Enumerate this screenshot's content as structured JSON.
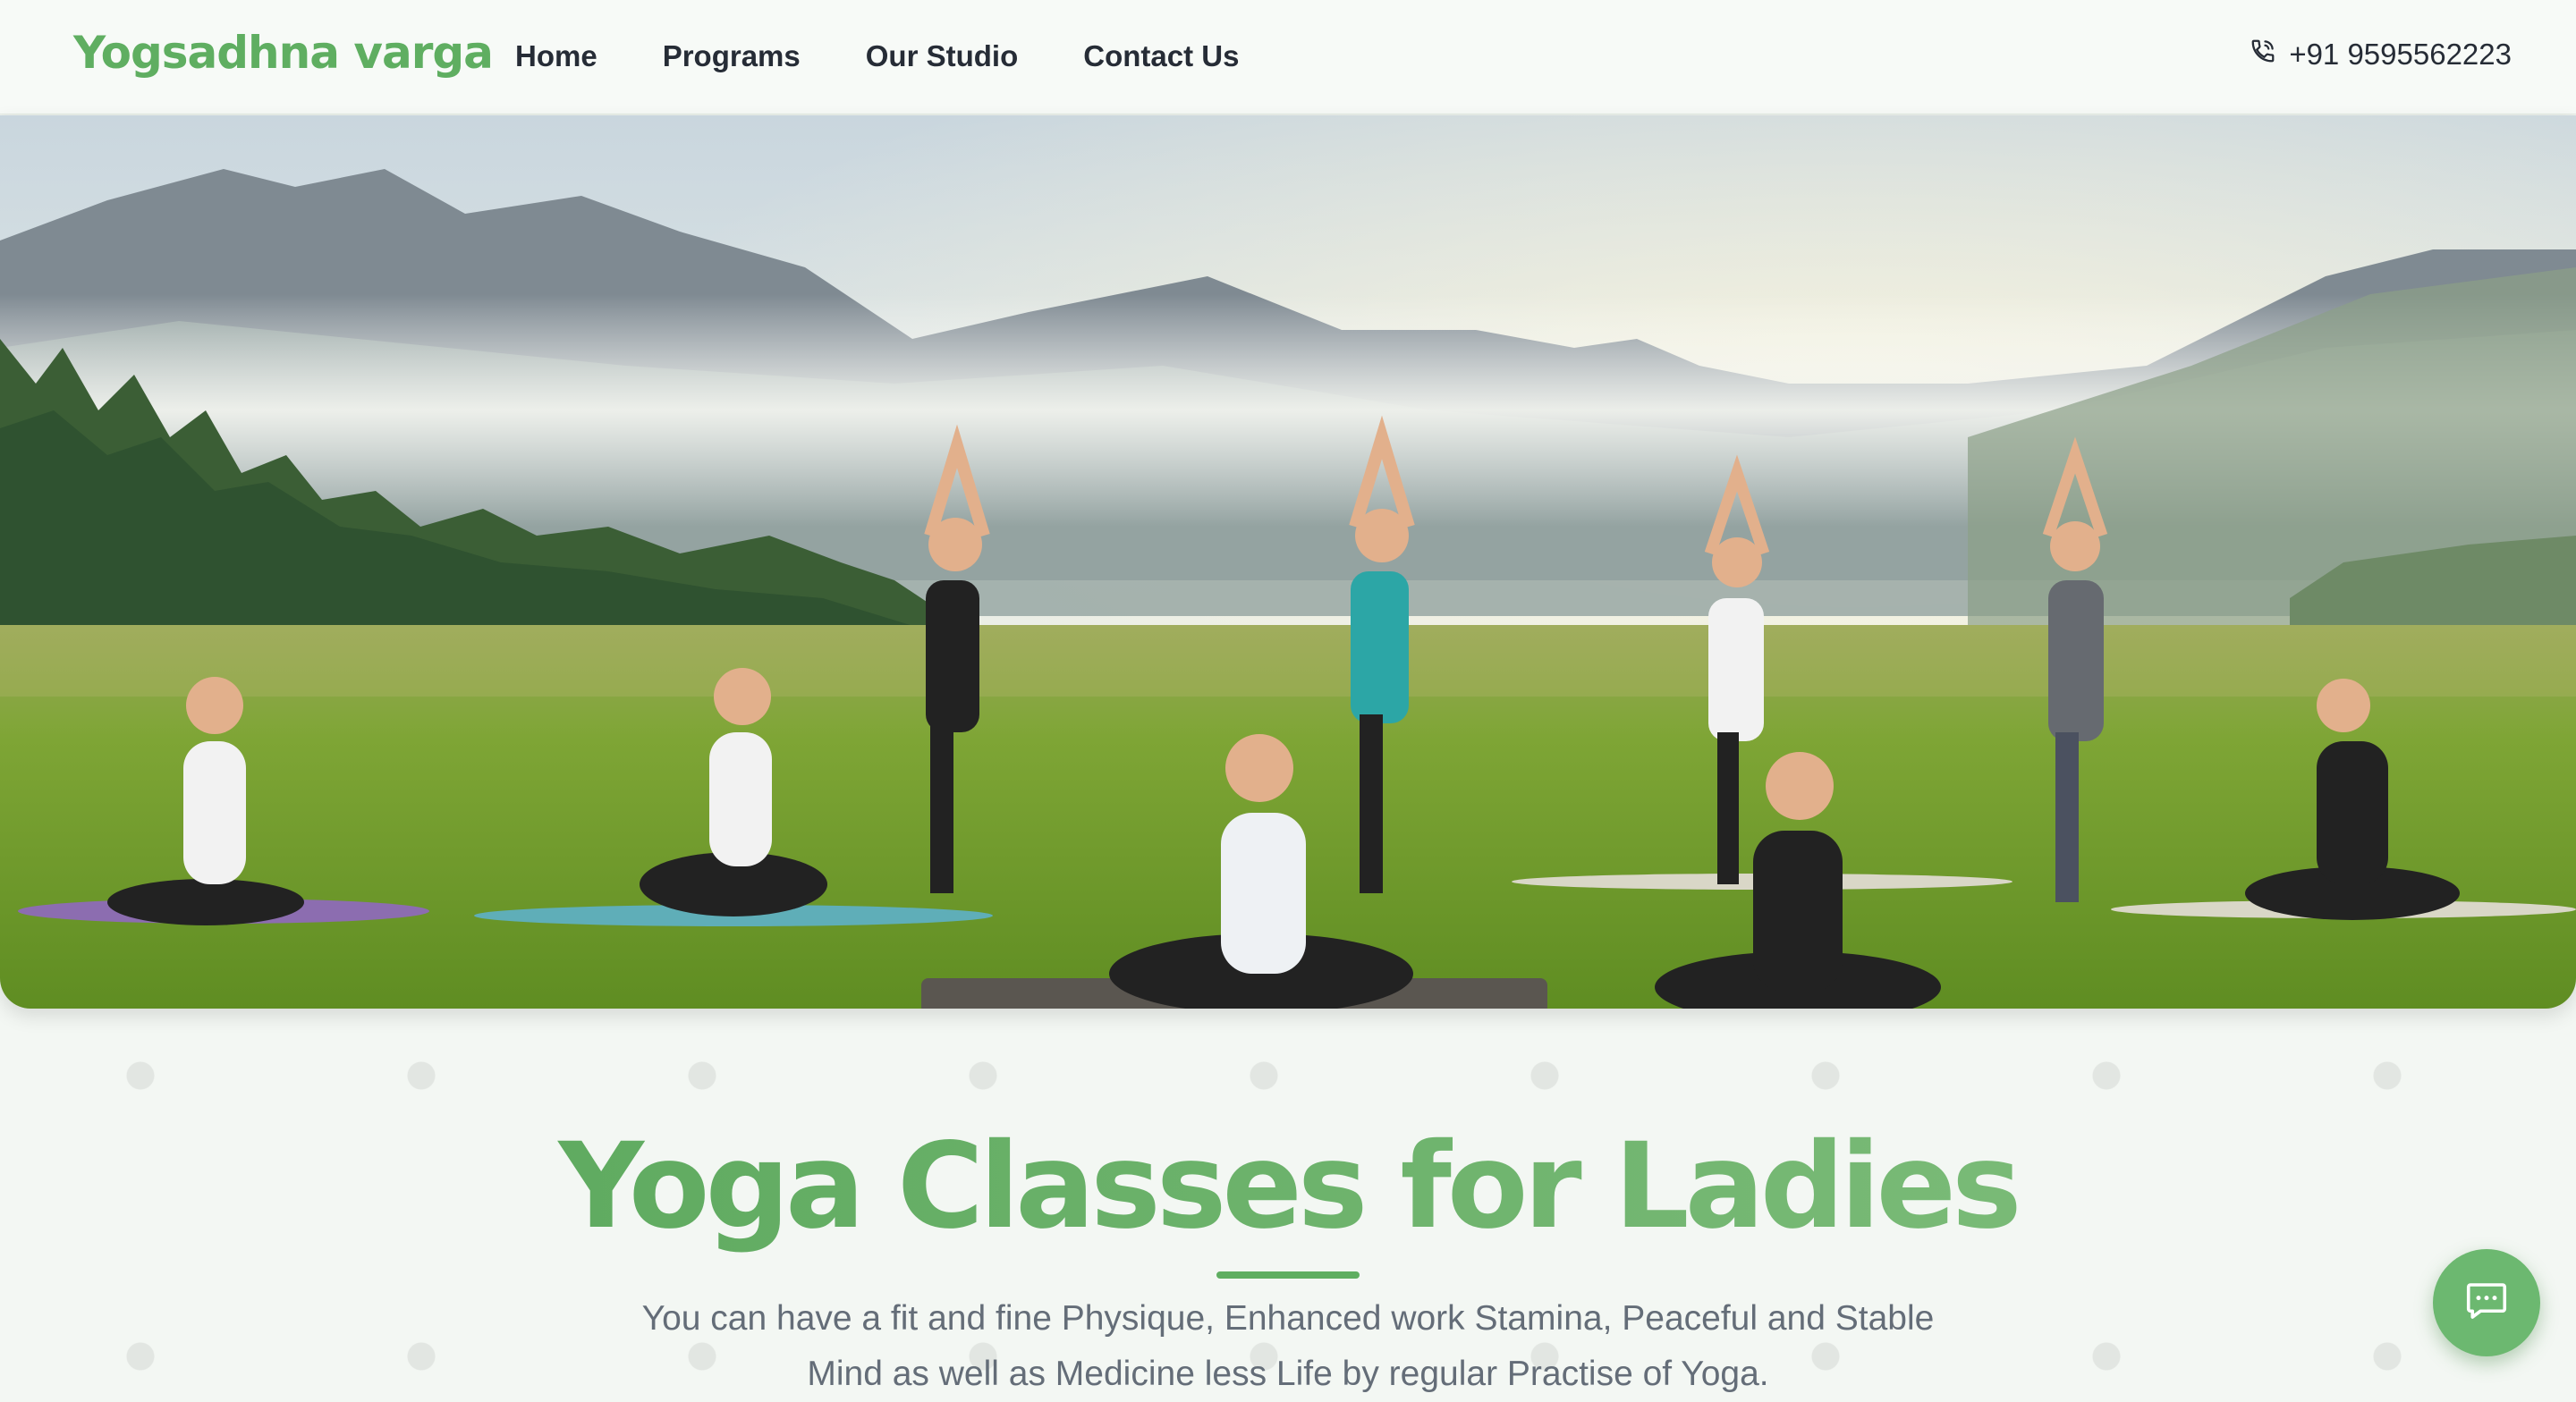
{
  "brand": {
    "name": "Yogsadhna varga"
  },
  "nav": {
    "items": [
      "Home",
      "Programs",
      "Our Studio",
      "Contact Us"
    ]
  },
  "contact": {
    "phone": "+91 9595562223",
    "icon": "phone-icon"
  },
  "hero": {
    "image_description_icon": "yoga-group-meadow-photo"
  },
  "main": {
    "heading": "Yoga Classes for Ladies",
    "subtitle": "You can have a fit and fine Physique, Enhanced work Stamina, Peaceful and Stable Mind as well as Medicine less Life by regular Practise of Yoga."
  },
  "chat_widget": {
    "icon": "chat-icon"
  },
  "colors": {
    "brand_green": "#5fae61",
    "nav_text": "#262c36",
    "subtitle_text": "#646d78",
    "chat_button": "#6cb870"
  }
}
